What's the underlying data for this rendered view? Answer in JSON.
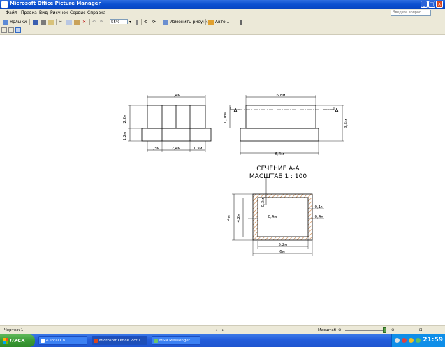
{
  "window": {
    "title": "Microsoft Office Picture Manager"
  },
  "menu": {
    "items": [
      "Файл",
      "Правка",
      "Вид",
      "Рисунок",
      "Сервис",
      "Справка"
    ],
    "help_placeholder": "Введите вопрос"
  },
  "toolbar": {
    "shortcuts_label": "Ярлыки",
    "zoom_value": "55%",
    "edit_label": "Изменить рисунки...",
    "auto_label": "Авто..."
  },
  "drawing": {
    "front_top_width": "1,4м",
    "front_upper_height": "2,2м",
    "front_base_height": "1,2м",
    "front_seg1": "1,3м",
    "front_seg2": "2,4м",
    "front_seg3": "1,3м",
    "side_top_width": "6,8м",
    "side_small_dim": "0,06м",
    "side_height": "3,5м",
    "side_base_width": "6,4м",
    "cut_label_left": "А",
    "cut_label_right": "А",
    "section_title": "СЕЧЕНИЕ А-А",
    "section_scale": "МАСШТАБ 1 : 100",
    "sec_top": "0,3м",
    "sec_outer_height": "4м",
    "sec_inner_height": "4,2м",
    "sec_wall_left": "0,4м",
    "sec_right1": "0,1м",
    "sec_right2": "0,4м",
    "sec_inner_width": "5,2м",
    "sec_outer_width": "6м"
  },
  "status": {
    "left": "Чертеж 1",
    "zoom_label": "Масштаб"
  },
  "taskbar": {
    "start_label": "ПУСК",
    "tasks": [
      "4 Total Co...",
      "Microsoft Office Pictu...",
      "MSN Messenger"
    ],
    "clock": "21:59"
  },
  "colors": {
    "titlebar": "#0a4fd0",
    "taskbar": "#245edb",
    "start": "#3a9a35",
    "hatch": "#c87a3a"
  }
}
